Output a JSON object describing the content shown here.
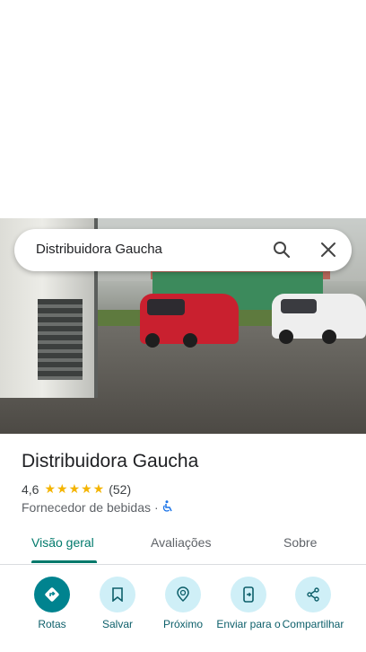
{
  "search": {
    "query": "Distribuidora Gaucha"
  },
  "place": {
    "name": "Distribuidora Gaucha",
    "rating": "4,6",
    "stars": "★★★★★",
    "review_count": "(52)",
    "category": "Fornecedor de bebidas",
    "separator": "·",
    "accessible_icon": "wheelchair-icon"
  },
  "tabs": [
    {
      "label": "Visão geral",
      "active": true
    },
    {
      "label": "Avaliações",
      "active": false
    },
    {
      "label": "Sobre",
      "active": false
    }
  ],
  "actions": [
    {
      "label": "Rotas",
      "icon": "directions-icon"
    },
    {
      "label": "Salvar",
      "icon": "bookmark-icon"
    },
    {
      "label": "Próximo",
      "icon": "nearby-icon"
    },
    {
      "label": "Enviar para o",
      "icon": "send-to-phone-icon"
    },
    {
      "label": "Compartilhar",
      "icon": "share-icon"
    }
  ],
  "colors": {
    "accent": "#00796b",
    "action_bg": "#cfeff7",
    "primary_action": "#00838f",
    "star": "#f4b400"
  }
}
